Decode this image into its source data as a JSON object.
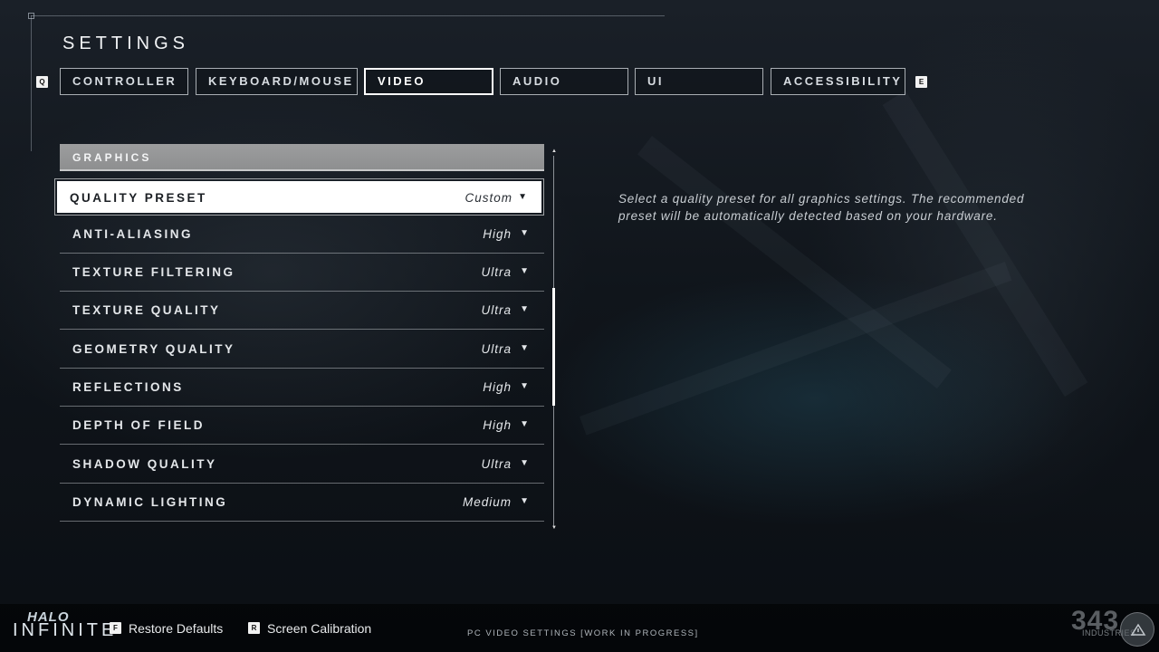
{
  "page": {
    "title": "SETTINGS"
  },
  "tabs": [
    {
      "label": "CONTROLLER",
      "active": false
    },
    {
      "label": "KEYBOARD/MOUSE",
      "active": false
    },
    {
      "label": "VIDEO",
      "active": true
    },
    {
      "label": "AUDIO",
      "active": false
    },
    {
      "label": "UI",
      "active": false
    },
    {
      "label": "ACCESSIBILITY",
      "active": false
    }
  ],
  "tab_hints": {
    "prev": "Q",
    "next": "E"
  },
  "section": {
    "header": "GRAPHICS"
  },
  "settings": [
    {
      "label": "QUALITY PRESET",
      "value": "Custom",
      "selected": true
    },
    {
      "label": "ANTI-ALIASING",
      "value": "High"
    },
    {
      "label": "TEXTURE FILTERING",
      "value": "Ultra"
    },
    {
      "label": "TEXTURE QUALITY",
      "value": "Ultra"
    },
    {
      "label": "GEOMETRY QUALITY",
      "value": "Ultra"
    },
    {
      "label": "REFLECTIONS",
      "value": "High"
    },
    {
      "label": "DEPTH OF FIELD",
      "value": "High"
    },
    {
      "label": "SHADOW QUALITY",
      "value": "Ultra"
    },
    {
      "label": "DYNAMIC LIGHTING",
      "value": "Medium"
    }
  ],
  "description": "Select a quality preset for all graphics settings. The recommended preset will be automatically detected based on your hardware.",
  "footer": {
    "logo_top": "HALO",
    "logo_bottom": "INFINITE",
    "restore_key": "F",
    "restore_label": "Restore Defaults",
    "calibration_key": "R",
    "calibration_label": "Screen Calibration",
    "note": "PC VIDEO SETTINGS [WORK IN PROGRESS]",
    "studio_mark": "343",
    "studio_sub": "INDUSTRIES"
  },
  "colors": {
    "selected_row_bg": "#ffffff",
    "section_header_bg": "#9c9d9e",
    "accent_text": "#e4e7ea"
  }
}
